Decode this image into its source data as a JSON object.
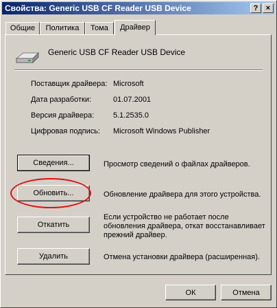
{
  "window": {
    "title": "Свойства: Generic USB CF Reader USB Device",
    "help_button": "?",
    "close_button": "×"
  },
  "tabs": [
    {
      "label": "Общие"
    },
    {
      "label": "Политика"
    },
    {
      "label": "Тома"
    },
    {
      "label": "Драйвер",
      "active": true
    }
  ],
  "device": {
    "icon": "drive-icon",
    "name": "Generic USB CF Reader USB Device"
  },
  "properties": [
    {
      "label": "Поставщик драйвера:",
      "value": "Microsoft"
    },
    {
      "label": "Дата разработки:",
      "value": "01.07.2001"
    },
    {
      "label": "Версия драйвера:",
      "value": "5.1.2535.0"
    },
    {
      "label": "Цифровая подпись:",
      "value": "Microsoft Windows Publisher"
    }
  ],
  "actions": {
    "details": {
      "label": "Сведения...",
      "description": "Просмотр сведений о файлах драйверов."
    },
    "update": {
      "label": "Обновить...",
      "description": "Обновление драйвера для этого устройства."
    },
    "rollback": {
      "label": "Откатить",
      "description": "Если устройство не работает после обновления драйвера, откат восстанавливает прежний драйвер."
    },
    "uninstall": {
      "label": "Удалить",
      "description": "Отмена установки драйвера (расширенная)."
    }
  },
  "footer": {
    "ok": "ОК",
    "cancel": "Отмена"
  },
  "colors": {
    "title_start": "#0a246a",
    "title_end": "#a6caf0",
    "highlight_ellipse": "#e01010"
  }
}
